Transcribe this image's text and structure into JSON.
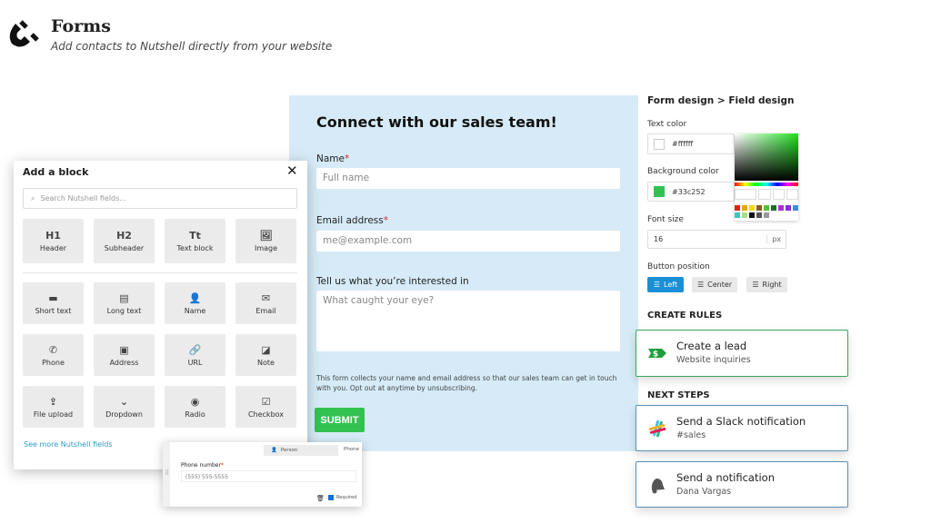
{
  "header": {
    "title": "Forms",
    "subtitle": "Add contacts to Nutshell directly from your website",
    "logo_icon": "magnet-icon"
  },
  "form": {
    "heading": "Connect with our sales team!",
    "fields": [
      {
        "label": "Name",
        "required": "*",
        "placeholder": "Full name"
      },
      {
        "label": "Email address",
        "required": "*",
        "placeholder": "me@example.com"
      },
      {
        "label": "Tell us what you’re interested in",
        "placeholder": "What caught your eye?"
      }
    ],
    "disclaimer": "This form collects your name and email address so that our sales team can get in touch with you. Opt out at anytime by unsubscribing.",
    "submit": "SUBMIT",
    "background": "#d6ebf7",
    "button_color": "#33c252"
  },
  "design": {
    "breadcrumb_1": "Form design",
    "sep": ">",
    "breadcrumb_2": "Field design",
    "text_color_label": "Text color",
    "text_color": "#ffffff",
    "bg_color_label": "Background color",
    "bg_color": "#33c252",
    "font_size_label": "Font size",
    "font_size": "16",
    "font_unit": "px",
    "button_pos_label": "Button position",
    "positions": [
      "Left",
      "Center",
      "Right"
    ],
    "selected_position": "Left",
    "swatches": [
      "#d9261c",
      "#e8a317",
      "#f5d90a",
      "#8b5a2b",
      "#55c22f",
      "#1f6b34",
      "#b02fd1",
      "#8a2be2",
      "#3b8fd9",
      "#36c9b5",
      "#a5e08a",
      "#111111",
      "#555555",
      "#999999",
      "#ffffff"
    ]
  },
  "rules": {
    "create_label": "CREATE RULES",
    "create": {
      "title": "Create a lead",
      "sub": "Website inquiries",
      "icon": "lead-dollar-icon"
    },
    "next_label": "NEXT STEPS",
    "steps": [
      {
        "title": "Send a Slack notification",
        "sub": "#sales",
        "icon": "slack-icon"
      },
      {
        "title": "Send a notification",
        "sub": "Dana Vargas",
        "icon": "bell-icon"
      }
    ]
  },
  "blocks": {
    "title": "Add a block",
    "search_placeholder": "Search Nutshell fields...",
    "top": [
      {
        "glyph": "H1",
        "label": "Header"
      },
      {
        "glyph": "H2",
        "label": "Subheader"
      },
      {
        "glyph": "Tt",
        "label": "Text block"
      },
      {
        "glyph": "🖼",
        "label": "Image"
      }
    ],
    "fields": [
      {
        "glyph": "▬",
        "label": "Short text"
      },
      {
        "glyph": "▤",
        "label": "Long text"
      },
      {
        "glyph": "👤",
        "label": "Name"
      },
      {
        "glyph": "✉",
        "label": "Email"
      },
      {
        "glyph": "✆",
        "label": "Phone"
      },
      {
        "glyph": "▣",
        "label": "Address"
      },
      {
        "glyph": "🔗",
        "label": "URL"
      },
      {
        "glyph": "◪",
        "label": "Note"
      },
      {
        "glyph": "⇪",
        "label": "File upload"
      },
      {
        "glyph": "⌄",
        "label": "Dropdown"
      },
      {
        "glyph": "◉",
        "label": "Radio"
      },
      {
        "glyph": "☑",
        "label": "Checkbox"
      }
    ],
    "more_link": "See more Nutshell fields"
  },
  "phone_card": {
    "entity": "Person",
    "type": "Phone",
    "label": "Phone number",
    "required": "*",
    "placeholder": "(555) 555-5555",
    "required_label": "Required"
  }
}
